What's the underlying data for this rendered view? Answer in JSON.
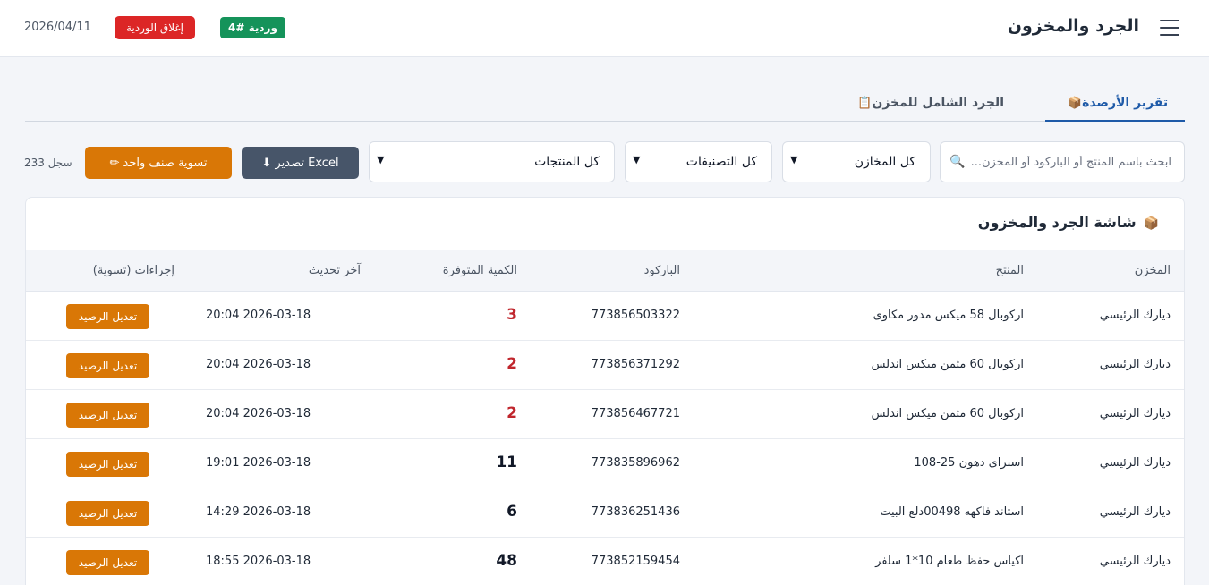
{
  "header": {
    "title": "الجرد والمخزون",
    "shift_badge": "وردية #4",
    "close_shift": "إغلاق الوردية",
    "date": "2026/04/11"
  },
  "tabs": [
    {
      "label": "تقرير الأرصدة",
      "icon": "box-icon"
    },
    {
      "label": "الجرد الشامل للمخزن",
      "icon": "clipboard-icon"
    }
  ],
  "filters": {
    "search_placeholder": "ابحث باسم المنتج أو الباركود أو المخزن...",
    "warehouse": "كل المخازن",
    "category": "كل التصنيفات",
    "product": "كل المنتجات",
    "export_label": "تصدير Excel",
    "adjust_label": "تسوية صنف واحد",
    "record_count": "233 سجل"
  },
  "table": {
    "title": "شاشة الجرد والمخزون",
    "columns": [
      "المخزن",
      "المنتج",
      "الباركود",
      "الكمية المتوفرة",
      "آخر تحديث",
      "إجراءات (تسوية)"
    ],
    "rows": [
      {
        "warehouse": "ديارك الرئيسي",
        "product": "اركوبال 58 ميكس مدور مكاوى",
        "barcode": "773856503322",
        "qty": "3",
        "updated": "2026-03-18 20:04",
        "action": "تعديل الرصيد"
      },
      {
        "warehouse": "ديارك الرئيسي",
        "product": "اركوبال 60 مثمن ميكس اندلس",
        "barcode": "773856371292",
        "qty": "2",
        "updated": "2026-03-18 20:04",
        "action": "تعديل الرصيد"
      },
      {
        "warehouse": "ديارك الرئيسي",
        "product": "اركوبال 60 مثمن ميكس اندلس",
        "barcode": "773856467721",
        "qty": "2",
        "updated": "2026-03-18 20:04",
        "action": "تعديل الرصيد"
      },
      {
        "warehouse": "ديارك الرئيسي",
        "product": "اسبراى دهون 25-108",
        "barcode": "773835896962",
        "qty": "11",
        "updated": "2026-03-18 19:01",
        "action": "تعديل الرصيد"
      },
      {
        "warehouse": "ديارك الرئيسي",
        "product": "استاند فاكهه 00498دلع البيت",
        "barcode": "773836251436",
        "qty": "6",
        "updated": "2026-03-18 14:29",
        "action": "تعديل الرصيد"
      },
      {
        "warehouse": "ديارك الرئيسي",
        "product": "اكياس حفظ طعام 10*1 سلفر",
        "barcode": "773852159454",
        "qty": "48",
        "updated": "2026-03-18 18:55",
        "action": "تعديل الرصيد"
      }
    ]
  },
  "colors": {
    "primary": "#1e5aa8",
    "danger": "#dc2626",
    "success": "#15935a",
    "warning": "#d97706",
    "low_stock": "#c0262d"
  }
}
